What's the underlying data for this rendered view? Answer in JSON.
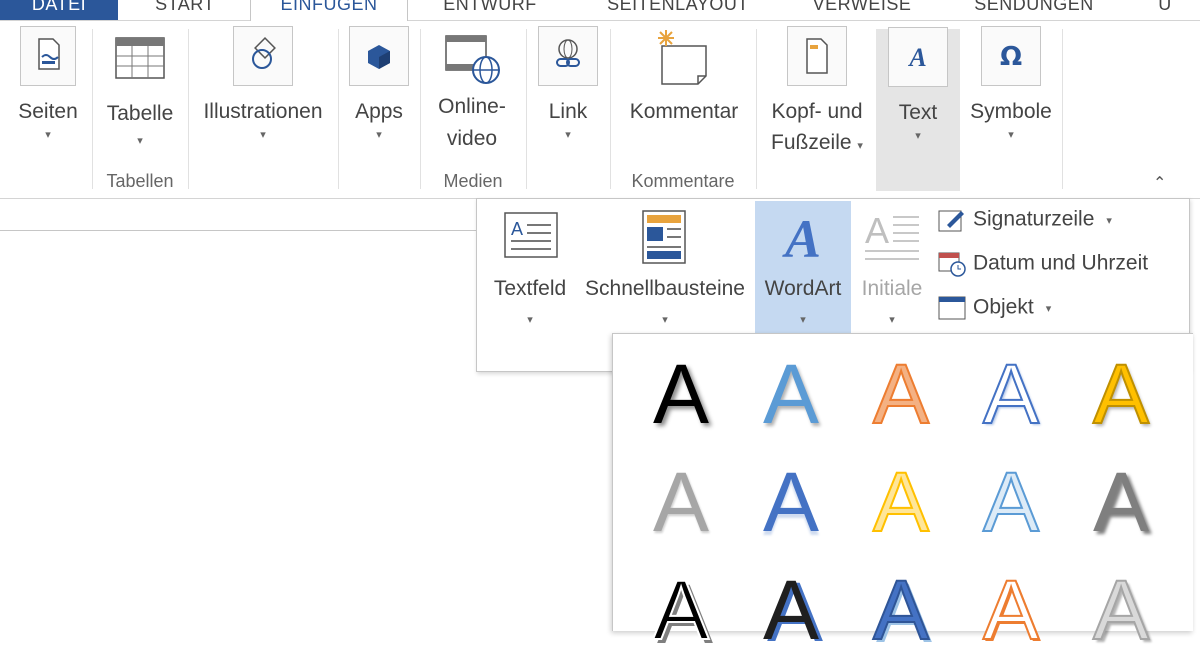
{
  "tabs": [
    {
      "label": "DATEI"
    },
    {
      "label": "START"
    },
    {
      "label": "EINFÜGEN"
    },
    {
      "label": "ENTWURF"
    },
    {
      "label": "SEITENLAYOUT"
    },
    {
      "label": "VERWEISE"
    },
    {
      "label": "SENDUNGEN"
    },
    {
      "label": "Ü"
    }
  ],
  "ribbon": {
    "commands": {
      "seiten": "Seiten",
      "tabelle": "Tabelle",
      "illustrationen": "Illustrationen",
      "apps": "Apps",
      "onlinevideo_1": "Online-",
      "onlinevideo_2": "video",
      "link": "Link",
      "kommentar": "Kommentar",
      "kopf_1": "Kopf- und",
      "kopf_2": "Fußzeile",
      "text": "Text",
      "symbole": "Symbole"
    },
    "groups": {
      "tabellen": "Tabellen",
      "medien": "Medien",
      "kommentare": "Kommentare"
    },
    "caret": "▾",
    "collapse": "⌃"
  },
  "text_panel": {
    "textfeld": "Textfeld",
    "schnellbausteine": "Schnellbausteine",
    "wordart": "WordArt",
    "initiale": "Initiale",
    "signaturzeile": "Signaturzeile",
    "datum": "Datum und Uhrzeit",
    "objekt": "Objekt"
  },
  "wordart_gallery": {
    "letter": "A",
    "styles": [
      {
        "fill": "#000000",
        "stroke": "none",
        "shadow": "3px 3px 4px rgba(0,0,0,0.45)"
      },
      {
        "fill": "#5b9bd5",
        "stroke": "none",
        "shadow": "2px 3px 3px rgba(0,0,0,0.3)"
      },
      {
        "fill": "#f4b183",
        "stroke": "#ed7d31",
        "shadow": "none"
      },
      {
        "fill": "#ffffff",
        "stroke": "#4472c4",
        "shadow": "2px 2px 2px rgba(68,114,196,0.4)"
      },
      {
        "fill": "#ffc000",
        "stroke": "#bf9000",
        "shadow": "2px 3px 3px rgba(0,0,0,0.3)"
      },
      {
        "fill": "#a6a6a6",
        "stroke": "none",
        "shadow": "1px 2px 2px rgba(0,0,0,0.2)"
      },
      {
        "fill": "#4472c4",
        "stroke": "none",
        "shadow": "0px 4px 2px rgba(68,114,196,0.25)"
      },
      {
        "fill": "#ffe699",
        "stroke": "#ffc000",
        "shadow": "none"
      },
      {
        "fill": "#ddebf7",
        "stroke": "#5b9bd5",
        "shadow": "none"
      },
      {
        "fill": "#7f7f7f",
        "stroke": "none",
        "shadow": "3px 3px 3px rgba(0,0,0,0.5)"
      },
      {
        "fill": "#000000",
        "stroke": "#ffffff",
        "shadow": "4px 4px 0px #7f7f7f"
      },
      {
        "fill": "#1f1f1f",
        "stroke": "none",
        "shadow": "4px 2px 0px #4472c4"
      },
      {
        "fill": "#4472c4",
        "stroke": "#2f5597",
        "shadow": "3px 3px 0px #9dc3e6"
      },
      {
        "fill": "#ffffff",
        "stroke": "#ed7d31",
        "shadow": "2px 2px 0px #ed7d31"
      },
      {
        "fill": "#d9d9d9",
        "stroke": "#a6a6a6",
        "shadow": "3px 3px 2px rgba(0,0,0,0.3)"
      }
    ]
  },
  "colors": {
    "accent": "#2b579a",
    "selected": "#c5d9f1"
  }
}
